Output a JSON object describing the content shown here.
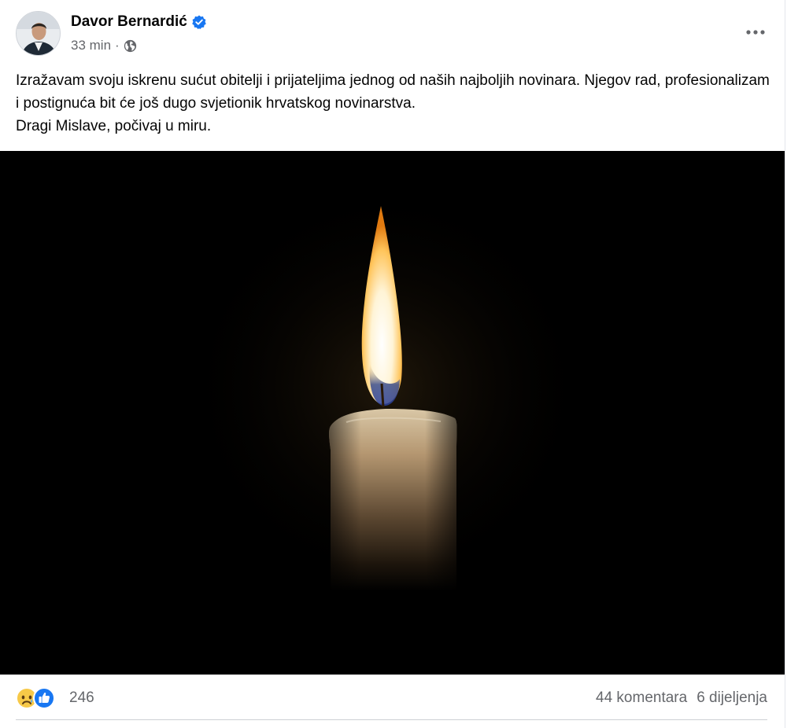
{
  "post": {
    "author": "Davor Bernardić",
    "timestamp": "33 min",
    "separator": "·",
    "audience_icon": "globe-icon",
    "verified_icon": "verified-badge-icon",
    "more_icon": "more-options-icon",
    "text_lines": [
      "Izražavam svoju iskrenu sućut obitelji i prijateljima jednog od naših najboljih novinara. Njegov rad, profesionalizam i postignuća bit će još dugo svjetionik hrvatskog novinarstva.",
      "Dragi Mislave, počivaj u miru."
    ]
  },
  "reactions": {
    "icons": [
      "sad-reaction-icon",
      "like-reaction-icon"
    ],
    "count": "246"
  },
  "stats": {
    "comments": "44 komentara",
    "shares": "6 dijeljenja"
  },
  "colors": {
    "verified_blue": "#1877f2",
    "secondary_text": "#65676b",
    "photo_background": "#000000"
  }
}
